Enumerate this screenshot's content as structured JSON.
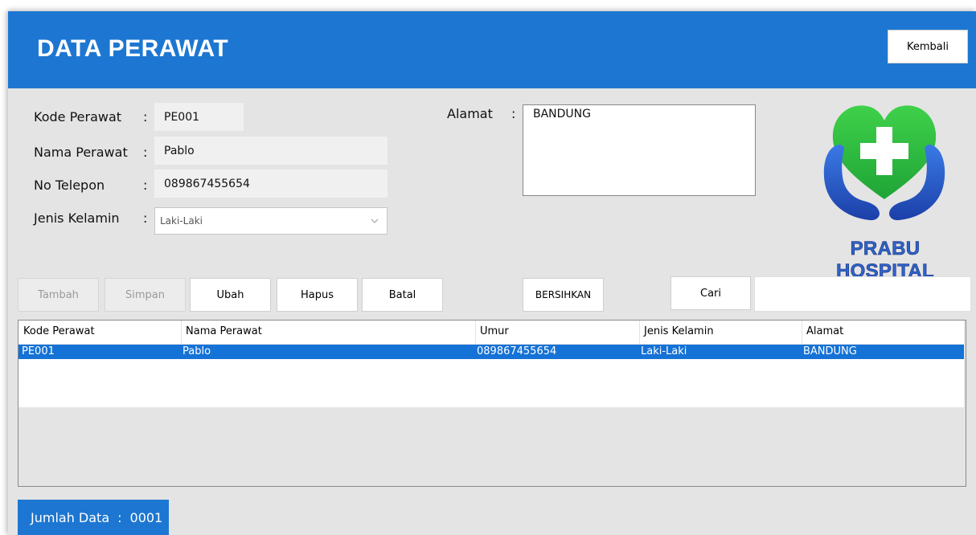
{
  "header": {
    "title": "DATA PERAWAT",
    "back_button": "Kembali"
  },
  "form": {
    "kode": {
      "label": "Kode Perawat",
      "colon": ":",
      "value": "PE001"
    },
    "nama": {
      "label": "Nama Perawat",
      "colon": ":",
      "value": "Pablo"
    },
    "telepon": {
      "label": "No Telepon",
      "colon": ":",
      "value": "089867455654"
    },
    "kelamin": {
      "label": "Jenis Kelamin",
      "colon": ":",
      "value": "Laki-Laki"
    },
    "alamat": {
      "label": "Alamat",
      "colon": ":",
      "value": "BANDUNG"
    }
  },
  "logo": {
    "text": "PRABU HOSPITAL",
    "icon": "heart-cross-hands-icon",
    "colors": {
      "heart": "#2cc13c",
      "hands": "#2b5fcf",
      "text": "#2f63c9"
    }
  },
  "buttons": {
    "tambah": "Tambah",
    "simpan": "Simpan",
    "ubah": "Ubah",
    "hapus": "Hapus",
    "batal": "Batal",
    "bersihkan": "BERSIHKAN",
    "cari": "Cari"
  },
  "search": {
    "value": ""
  },
  "table": {
    "columns": [
      "Kode Perawat",
      "Nama Perawat",
      "Umur",
      "Jenis Kelamin",
      "Alamat"
    ],
    "rows": [
      [
        "PE001",
        "Pablo",
        "089867455654",
        "Laki-Laki",
        "BANDUNG"
      ]
    ]
  },
  "footer": {
    "label": "Jumlah Data",
    "colon": ":",
    "count": "0001"
  },
  "colors": {
    "accent": "#1d77d2",
    "selection": "#1572d6",
    "window_bg": "#e4e4e4"
  }
}
